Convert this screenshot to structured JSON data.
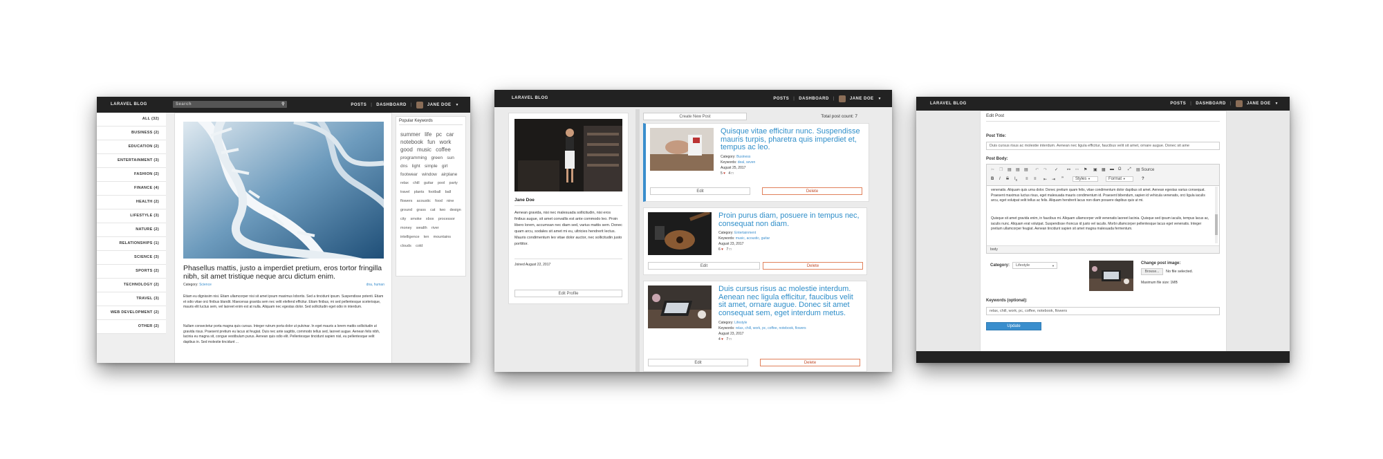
{
  "blog_home": {
    "brand": "LARAVEL BLOG",
    "search_placeholder": "Search",
    "nav_posts": "POSTS",
    "nav_dashboard": "DASHBOARD",
    "user": "JANE DOE",
    "categories": [
      "ALL (32)",
      "BUSINESS (2)",
      "EDUCATION (2)",
      "ENTERTAINMENT (3)",
      "FASHION (2)",
      "FINANCE (4)",
      "HEALTH (2)",
      "LIFESTYLE (3)",
      "NATURE (2)",
      "RELATIONSHIPS (1)",
      "SCIENCE (3)",
      "SPORTS (2)",
      "TECHNOLOGY (2)",
      "TRAVEL (3)",
      "WEB DEVELOPMENT (2)",
      "OTHER (2)"
    ],
    "post_title": "Phasellus mattis, justo a imperdiet pretium, eros tortor fringilla nibh, sit amet tristique neque arcu dictum enim.",
    "category_label": "Category:",
    "category_value": "Science",
    "tags": "dna, human",
    "paragraph1": "Etiam eu dignissim nisi. Etiam ullamcorper nisi sit amet ipsum maximus lobortis. Sed a tincidunt ipsum. Suspendisse potenti. Etiam et odio vitae orci finibus blandit. Maecenas gravida sem nec velit eleifend efficitur. Etiam finibus, mi sed pellentesque scelerisque, mauris elit luctus sem, vel laoreet enim est at nulla. Aliquam nec egestas dolor. Sed sollicitudin eget odio in interdum.",
    "paragraph2": "Nullam consectetur porta magna quis cursus. Integer rutrum porta dolor ut pulvinar. In eget mauris a lorem mattis sollicitudin ut gravida risus. Praesent pretium eu lacus at feugiat. Duis nec ante sagittis, commodo tellus sed, laoreet augue. Aenean felis nibh, lacinia eu magna sit, congue vestibulum purus. Aenean quis odio elit. Pellentesque tincidunt sapien nisl, eu pellentesque velit dapibus in. Sed molestie tincidunt ...",
    "keywords_title": "Popular Keywords",
    "keywords": [
      "summer",
      "life",
      "pc",
      "car",
      "notebook",
      "fun",
      "work",
      "good",
      "music",
      "coffee",
      "programming",
      "green",
      "sun",
      "dns",
      "light",
      "simple",
      "girl",
      "footwear",
      "window",
      "airplane",
      "relax",
      "chill",
      "guitar",
      "pool",
      "party",
      "travel",
      "plants",
      "football",
      "ball",
      "flowers",
      "acoustic",
      "food",
      "nine",
      "ground",
      "grass",
      "cat",
      "two",
      "design",
      "city",
      "smoke",
      "xbox",
      "processor",
      "money",
      "wealth",
      "river",
      "intelligence",
      "ten",
      "mountains",
      "clouds",
      "cold"
    ]
  },
  "dashboard": {
    "brand": "LARAVEL BLOG",
    "nav_posts": "POSTS",
    "nav_dashboard": "DASHBOARD",
    "user": "JANE DOE",
    "profile_name": "Jane Doe",
    "profile_bio": "Aenean gravida, nisi nec malesuada sollicitudin, nisi eros finibus augue, sit amet convallis est ante commodo leo. Proin libero lorem, accumsan nec diam sed, varius mattis sem. Donec quam arcu, sodales sit amet mi eu, ultricies hendrerit lectus. Mauris condimentum leo vitae dolor auctor, nec sollicitudin justo porttitor.",
    "joined": "Joined August 22, 2017",
    "edit_profile": "Edit Profile",
    "create_post": "Create New Post",
    "post_count": "Total post count: 7",
    "edit_label": "Edit",
    "delete_label": "Delete",
    "posts": [
      {
        "title": "Quisque vitae efficitur nunc. Suspendisse mauris turpis, pharetra quis imperdiet et, tempus ac leo.",
        "category": "Business",
        "keywords": "deal, seven",
        "date": "August 25, 2017",
        "likes": "5",
        "comments": "4"
      },
      {
        "title": "Proin purus diam, posuere in tempus nec, consequat non diam.",
        "category": "Entertainment",
        "keywords": "music, acoustic, guitar",
        "date": "August 23, 2017",
        "likes": "6",
        "comments": "7"
      },
      {
        "title": "Duis cursus risus ac molestie interdum. Aenean nec ligula efficitur, faucibus velit sit amet, ornare augue. Donec sit amet consequat sem, eget interdum metus.",
        "category": "Lifestyle",
        "keywords": "relax, chill, work, pc, coffee, notebook, flowers",
        "date": "August 23, 2017",
        "likes": "4",
        "comments": "7"
      }
    ]
  },
  "editor": {
    "brand": "LARAVEL BLOG",
    "nav_posts": "POSTS",
    "nav_dashboard": "DASHBOARD",
    "user": "JANE DOE",
    "heading": "Edit Post",
    "title_label": "Post Title:",
    "title_value": "Duis cursus risus ac molestie interdum. Aenean nec ligula efficitur, faucibus velit sit amet, ornare augue. Donec sit ame",
    "body_label": "Post Body:",
    "toolbar_source": "Source",
    "toolbar_styles": "Styles",
    "toolbar_format": "Format",
    "body_text1": "venenatis. Aliquam quis urna dolor. Donec pretium quam felis, vitae condimentum dolor dapibus sit amet. Aenean egestas varius consequat. Praesent maximus luctus risus, eget malesuada mauris condimentum id. Praesent bibendum, sapien id vehicula venenatis, orci ligula iaculis arcu, eget volutpat velit tellus ac felis. Aliquam hendrerit lacus non diam posuere dapibus quis ut mi.",
    "body_text2": "Quisque sit amet gravida enim, in faucibus mi. Aliquam ullamcorper velit venenatis laoreet lacinia. Quisque sed ipsum iaculis, tempus lacus ac, iaculis nunc. Aliquam erat volutpat. Suspendisse rhoncus id justo vel iaculis. Morbi ullamcorper pellentesque lacus eget venenatis. Integer pretium ullamcorper feugiat. Aenean tincidunt sapien sit amet magna malesuada fermentum.",
    "status_path": "body",
    "category_label": "Category:",
    "category_value": "Lifestyle",
    "change_image": "Change post image:",
    "browse": "Browse...",
    "no_file": "No file selected.",
    "max_size": "Maximum file size: 1MB",
    "keywords_label": "Keywords (optional):",
    "keywords_value": "relax, chill, work, pc, coffee, notebook, flowers",
    "update": "Update"
  }
}
